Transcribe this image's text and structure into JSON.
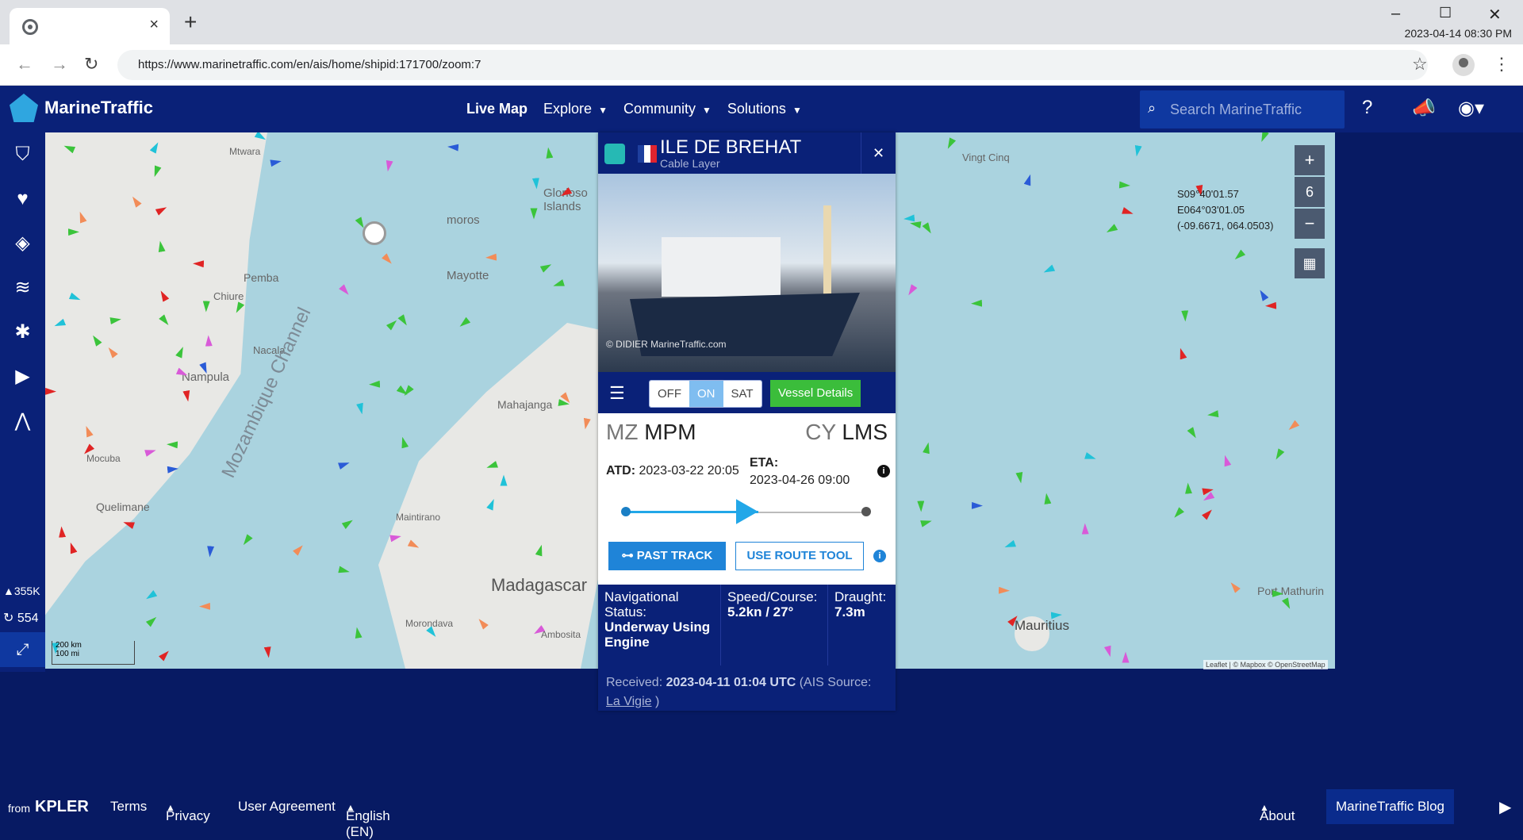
{
  "browser": {
    "url": "https://www.marinetraffic.com/en/ais/home/shipid:171700/zoom:7",
    "clock": "2023-04-14 08:30 PM",
    "new_tab": "+",
    "close_tab": "×",
    "min": "–",
    "max": "☐",
    "close": "✕"
  },
  "header": {
    "logo": "MarineTraffic",
    "nav": [
      "Live Map",
      "Explore",
      "Community",
      "Solutions"
    ],
    "search_placeholder": "Search MarineTraffic"
  },
  "sidebar": {
    "stat_ships": "355K",
    "stat_count": "554"
  },
  "map": {
    "labels": [
      "Glorioso Islands",
      "Mayotte",
      "Pemba",
      "Chiure",
      "Nacala",
      "Nampula",
      "Mozambique Channel",
      "Mocuba",
      "Quelimane",
      "Mahajanga",
      "Maintirano",
      "Madagascar",
      "Morondava",
      "Ambosita",
      "Mauritius",
      "Port Mathurin",
      "Vingt Cinq",
      "Mtwara",
      "moros"
    ],
    "zoom_level": "6",
    "coords": [
      "S09°40'01.57",
      "E064°03'01.05",
      "(-09.6671, 064.0503)"
    ],
    "scale": [
      "200 km",
      "100 mi"
    ],
    "attribution": "Leaflet | © Mapbox © OpenStreetMap"
  },
  "vessel": {
    "name": "ILE DE BREHAT",
    "type": "Cable Layer",
    "photo_credit": "© DIDIER MarineTraffic.com",
    "layers": [
      "OFF",
      "ON",
      "SAT"
    ],
    "details_btn": "Vessel Details",
    "from_cc": "MZ",
    "from_port": "MPM",
    "to_cc": "CY",
    "to_port": "LMS",
    "atd_label": "ATD:",
    "atd": "2023-03-22 20:05",
    "eta_label": "ETA:",
    "eta": "2023-04-26 09:00",
    "progress": 0.55,
    "past_track": "PAST TRACK",
    "route_tool": "USE ROUTE TOOL",
    "nav_status_label": "Navigational Status:",
    "nav_status": "Underway Using Engine",
    "speed_label": "Speed/Course:",
    "speed": "5.2kn / 27°",
    "draught_label": "Draught:",
    "draught": "7.3m",
    "received_label": "Received:",
    "received": "2023-04-11 01:04 UTC",
    "ais_source_label": "(AIS Source:",
    "ais_source": "La Vigie",
    "close_paren": ")"
  },
  "footer": {
    "from": "from",
    "brand": "KPLER",
    "links": [
      "Terms",
      "Privacy",
      "User Agreement",
      "English (EN)"
    ],
    "about": "About",
    "blog": "MarineTraffic Blog"
  }
}
